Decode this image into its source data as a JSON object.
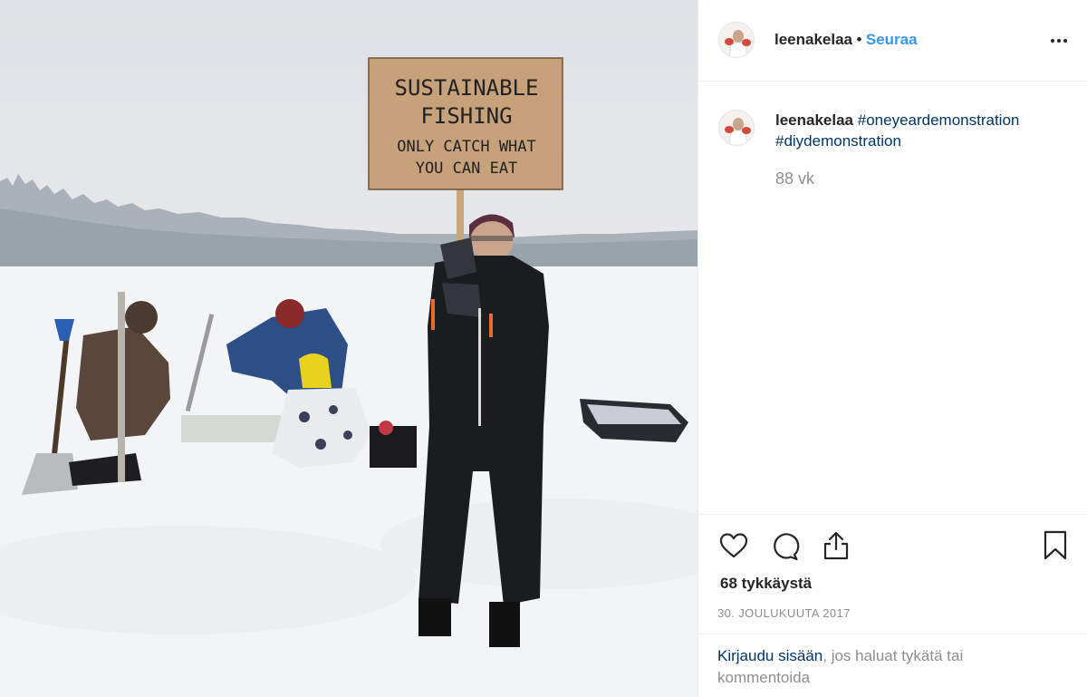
{
  "post": {
    "username": "leenakelaa",
    "separator": "•",
    "follow_label": "Seuraa",
    "more_label": "Lisää vaihtoehtoja",
    "caption": {
      "username": "leenakelaa",
      "hashtags": [
        "#oneyeardemonstration",
        "#diydemonstration"
      ]
    },
    "time_ago": "88 vk",
    "likes": "68 tykkäystä",
    "date": "30. JOULUKUUTA 2017",
    "login_link": "Kirjaudu sisään",
    "login_rest": ", jos haluat tykätä tai kommentoida"
  },
  "photo": {
    "sign_line1": "SUSTAINABLE",
    "sign_line2": "FISHING",
    "sign_line3": "ONLY CATCH WHAT",
    "sign_line4": "YOU CAN EAT"
  },
  "icons": [
    "heart-icon",
    "comment-icon",
    "share-icon",
    "bookmark-icon",
    "more-icon"
  ],
  "colors": {
    "link_blue": "#3897f0",
    "hashtag_navy": "#003569",
    "muted": "#8e8e8e",
    "text": "#262626"
  }
}
